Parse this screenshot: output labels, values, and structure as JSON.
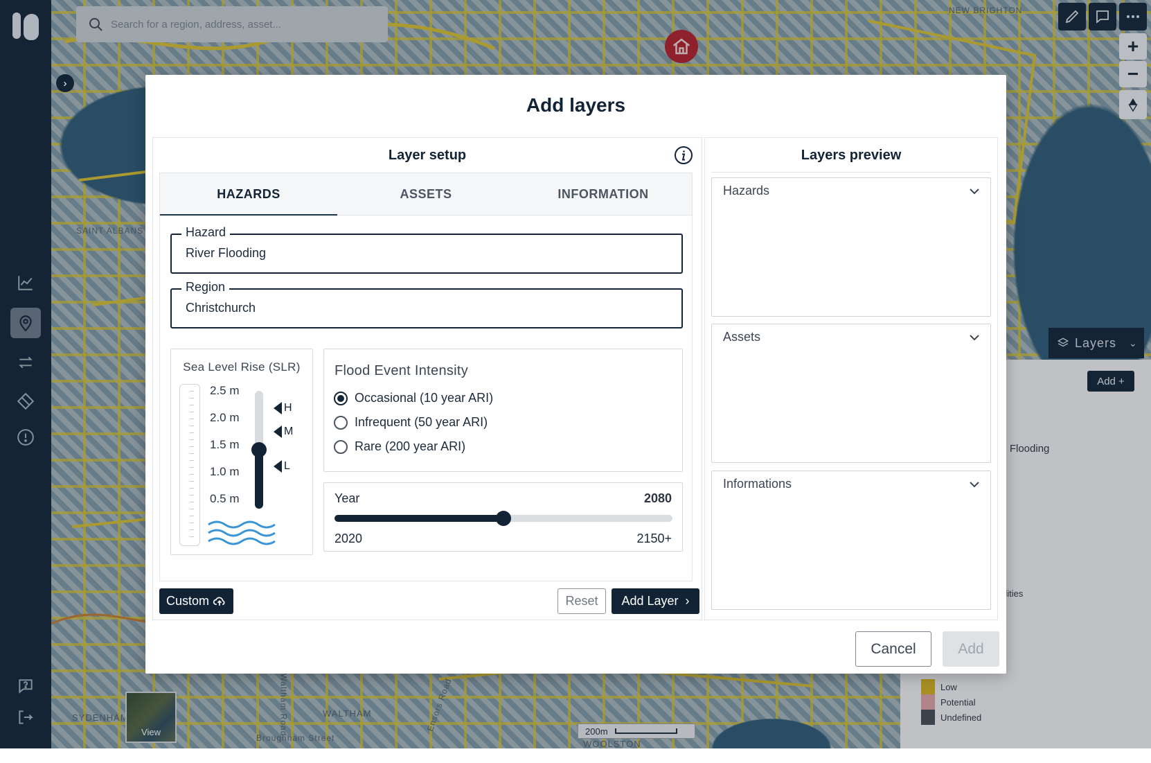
{
  "map": {
    "search_placeholder": "Search for a region, address, asset...",
    "view_label": "View",
    "scale_label": "200m",
    "layers_button": "Layers",
    "layers_add_button": "Add +",
    "peek_flooding": "al Flooding",
    "peek_facilities": "cilities",
    "place_labels": [
      "SYDENHAM",
      "WALTHAM",
      "WOOLSTON",
      "Broughham Street",
      "Ensors Road",
      "Waltham Road",
      "SAINT ALBANS",
      "NEW BRIGHTON"
    ],
    "legend": [
      {
        "label": "Low",
        "color": "#d6b21f"
      },
      {
        "label": "Potential",
        "color": "#e2a2a8"
      },
      {
        "label": "Undefined",
        "color": "#454b51"
      }
    ]
  },
  "modal": {
    "title": "Add layers",
    "setup": {
      "title": "Layer setup",
      "tabs": [
        {
          "label": "HAZARDS",
          "active": true
        },
        {
          "label": "ASSETS",
          "active": false
        },
        {
          "label": "INFORMATION",
          "active": false
        }
      ],
      "hazard": {
        "label": "Hazard",
        "value": "River Flooding"
      },
      "region": {
        "label": "Region",
        "value": "Christchurch"
      },
      "slr": {
        "title": "Sea Level Rise (SLR)",
        "ticks": [
          "2.5 m",
          "2.0 m",
          "1.5 m",
          "1.0 m",
          "0.5 m"
        ],
        "value_m": 1.5,
        "markers": [
          "H",
          "M",
          "L"
        ]
      },
      "flood": {
        "title": "Flood Event Intensity",
        "options": [
          {
            "label": "Occasional (10 year ARI)",
            "checked": true
          },
          {
            "label": "Infrequent (50 year ARI)",
            "checked": false
          },
          {
            "label": "Rare (200 year ARI)",
            "checked": false
          }
        ]
      },
      "year": {
        "label": "Year",
        "value": 2080,
        "value_text": "2080",
        "min": 2020,
        "min_label": "2020",
        "max_label": "2150+",
        "fill_fraction": 0.5
      },
      "buttons": {
        "custom": "Custom",
        "reset": "Reset",
        "add_layer": "Add Layer"
      }
    },
    "preview": {
      "title": "Layers preview",
      "sections": [
        "Hazards",
        "Assets",
        "Informations"
      ]
    },
    "footer": {
      "cancel": "Cancel",
      "add": "Add"
    }
  },
  "colors": {
    "navy": "#122336",
    "flood_blue": "#3a95d8",
    "alert_red": "#b41f2b"
  }
}
